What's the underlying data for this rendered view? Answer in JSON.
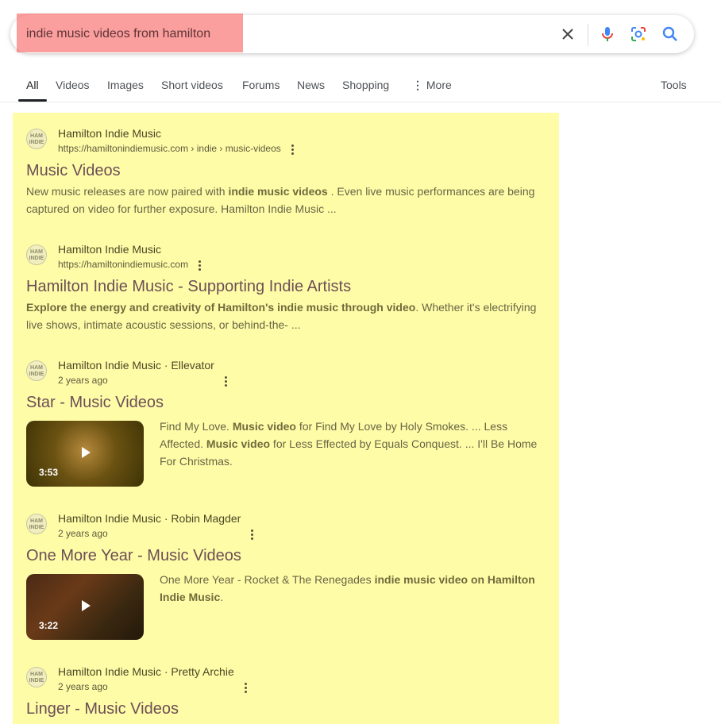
{
  "search": {
    "query": "indie music videos from hamilton"
  },
  "icons": {
    "clear": "close-icon",
    "voice": "microphone-icon",
    "lens": "lens-camera-icon",
    "search": "search-icon"
  },
  "tabs": [
    {
      "label": "All",
      "active": true
    },
    {
      "label": "Videos"
    },
    {
      "label": "Images"
    },
    {
      "label": "Short videos"
    },
    {
      "label": "Forums"
    },
    {
      "label": "News"
    },
    {
      "label": "Shopping"
    },
    {
      "label": "More"
    }
  ],
  "tools_label": "Tools",
  "favicon_text": "HAM INDIE",
  "results": [
    {
      "site": "Hamilton Indie Music",
      "url": "https://hamiltonindiemusic.com › indie › music-videos",
      "title": "Music Videos",
      "snippet_parts": [
        "New music releases are now paired with ",
        "indie music videos",
        " . Even live music performances are being captured on video for further exposure. Hamilton Indie Music ..."
      ]
    },
    {
      "site": "Hamilton Indie Music",
      "url": "https://hamiltonindiemusic.com",
      "title": "Hamilton Indie Music - Supporting Indie Artists",
      "snippet_parts": [
        "Explore the energy and creativity of Hamilton's indie music through video",
        ". Whether it's electrifying live shows, intimate acoustic sessions, or behind-the- ..."
      ]
    },
    {
      "site": "Hamilton Indie Music · Ellevator",
      "age": "2 years ago",
      "title": "Star - Music Videos",
      "duration": "3:53",
      "snippet_parts": [
        "Find My Love. ",
        "Music video",
        " for Find My Love by Holy Smokes. ... Less Affected. ",
        "Music video",
        " for Less Effected by Equals Conquest. ... I'll Be Home For Christmas."
      ]
    },
    {
      "site": "Hamilton Indie Music · Robin Magder",
      "age": "2 years ago",
      "title": "One More Year - Music Videos",
      "duration": "3:22",
      "snippet_parts": [
        "One More Year - Rocket & The Renegades ",
        "indie music video on Hamilton Indie Music",
        "."
      ]
    },
    {
      "site": "Hamilton Indie Music · Pretty Archie",
      "age": "2 years ago",
      "title": "Linger - Music Videos"
    }
  ],
  "colors": {
    "highlight_yellow": "#fffca8",
    "highlight_red": "#f76262"
  }
}
